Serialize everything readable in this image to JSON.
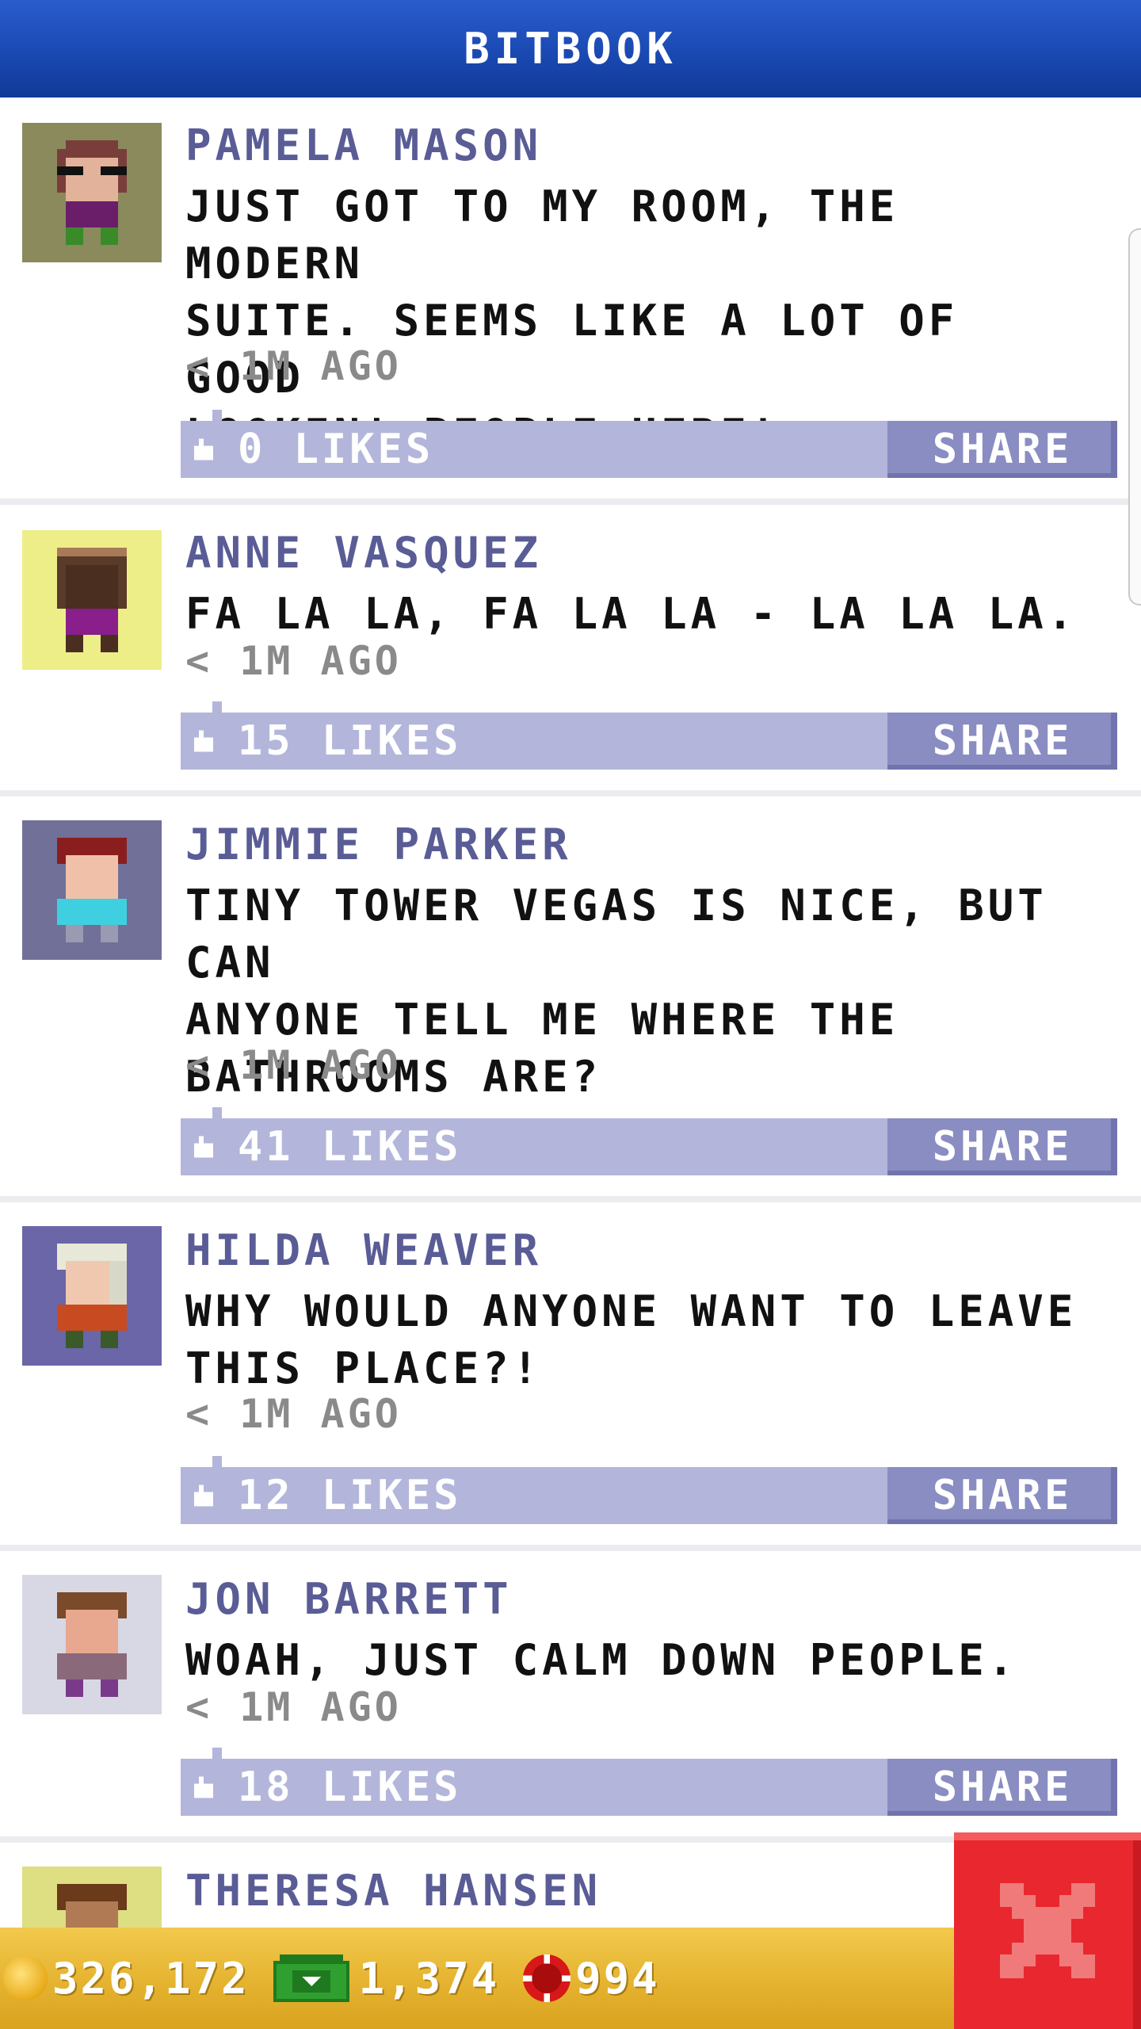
{
  "header": {
    "title": "BITBOOK"
  },
  "posts": [
    {
      "name": "PAMELA MASON",
      "lines": [
        "JUST GOT TO MY ROOM, THE MODERN",
        "SUITE. SEEMS LIKE A LOT OF GOOD",
        "LOOKIN' PEOPLE HERE!"
      ],
      "time": "< 1M AGO",
      "likes": "0 LIKES",
      "share": "SHARE",
      "avatar_bg": "#8a8a5c"
    },
    {
      "name": "ANNE VASQUEZ",
      "lines": [
        "FA LA LA, FA LA LA - LA LA LA."
      ],
      "time": "< 1M AGO",
      "likes": "15 LIKES",
      "share": "SHARE",
      "avatar_bg": "#eeee88"
    },
    {
      "name": "JIMMIE PARKER",
      "lines": [
        "TINY TOWER VEGAS IS NICE, BUT CAN",
        "ANYONE TELL ME WHERE THE",
        "BATHROOMS ARE?"
      ],
      "time": "< 1M AGO",
      "likes": "41 LIKES",
      "share": "SHARE",
      "avatar_bg": "#707098"
    },
    {
      "name": "HILDA WEAVER",
      "lines": [
        "WHY WOULD ANYONE WANT TO LEAVE",
        "THIS PLACE?!"
      ],
      "time": "< 1M AGO",
      "likes": "12 LIKES",
      "share": "SHARE",
      "avatar_bg": "#6a66a8"
    },
    {
      "name": "JON BARRETT",
      "lines": [
        "WOAH, JUST CALM DOWN PEOPLE."
      ],
      "time": "< 1M AGO",
      "likes": "18 LIKES",
      "share": "SHARE",
      "avatar_bg": "#d8d8e4"
    },
    {
      "name": "THERESA HANSEN",
      "avatar_bg": "#dede82"
    }
  ],
  "footer": {
    "coins": "326,172",
    "bux": "1,374",
    "chips": "994"
  },
  "colors": {
    "header": "#1a49b3",
    "name": "#5a5c96",
    "like_bar": "#b3b6da",
    "share_button": "#8a8dc2",
    "footer": "#e6b532",
    "close": "#e8282e"
  },
  "icons": {
    "like": "thumbs-up-icon",
    "coin": "coin-icon",
    "bux": "bux-icon",
    "chip": "poker-chip-icon",
    "close": "close-icon"
  }
}
